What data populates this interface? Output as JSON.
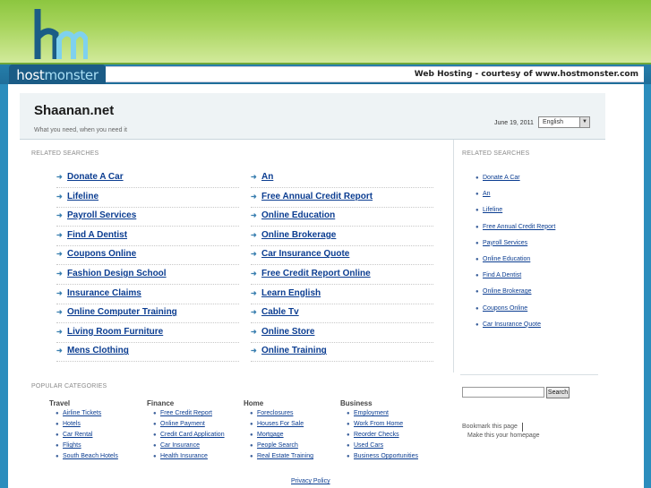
{
  "banner": {
    "logo_letters": "hm",
    "logo_word_host": "host",
    "logo_word_monster": "monster",
    "courtesy": "Web Hosting - courtesy of www.hostmonster.com"
  },
  "header": {
    "title": "Shaanan.net",
    "tagline": "What you need, when you need it",
    "date": "June 19, 2011",
    "language": "English"
  },
  "related": {
    "heading": "RELATED SEARCHES",
    "left": [
      "Donate A Car",
      "Lifeline",
      "Payroll Services",
      "Find A Dentist",
      "Coupons Online",
      "Fashion Design School",
      "Insurance Claims",
      "Online Computer Training",
      "Living Room Furniture",
      "Mens Clothing"
    ],
    "right": [
      "An",
      "Free Annual Credit Report",
      "Online Education",
      "Online Brokerage",
      "Car Insurance Quote",
      "Free Credit Report Online",
      "Learn English",
      "Cable Tv",
      "Online Store",
      "Online Training"
    ]
  },
  "sidebar": {
    "heading": "RELATED SEARCHES",
    "items": [
      "Donate A Car",
      "An",
      "Lifeline",
      "Free Annual Credit Report",
      "Payroll Services",
      "Online Education",
      "Find A Dentist",
      "Online Brokerage",
      "Coupons Online",
      "Car Insurance Quote"
    ],
    "search_button": "Search",
    "bookmark": "Bookmark this page",
    "homepage": "Make this your homepage"
  },
  "popular": {
    "heading": "POPULAR CATEGORIES",
    "categories": [
      {
        "title": "Travel",
        "items": [
          "Airline Tickets",
          "Hotels",
          "Car Rental",
          "Flights",
          "South Beach Hotels"
        ]
      },
      {
        "title": "Finance",
        "items": [
          "Free Credit Report",
          "Online Payment",
          "Credit Card Application",
          "Car Insurance",
          "Health Insurance"
        ]
      },
      {
        "title": "Home",
        "items": [
          "Foreclosures",
          "Houses For Sale",
          "Mortgage",
          "People Search",
          "Real Estate Training"
        ]
      },
      {
        "title": "Business",
        "items": [
          "Employment",
          "Work From Home",
          "Reorder Checks",
          "Used Cars",
          "Business Opportunities"
        ]
      }
    ]
  },
  "footer": {
    "privacy": "Privacy Policy"
  },
  "colors": {
    "link": "#0b3d91",
    "banner_green": "#8cc63f",
    "banner_blue": "#2e94c0"
  }
}
